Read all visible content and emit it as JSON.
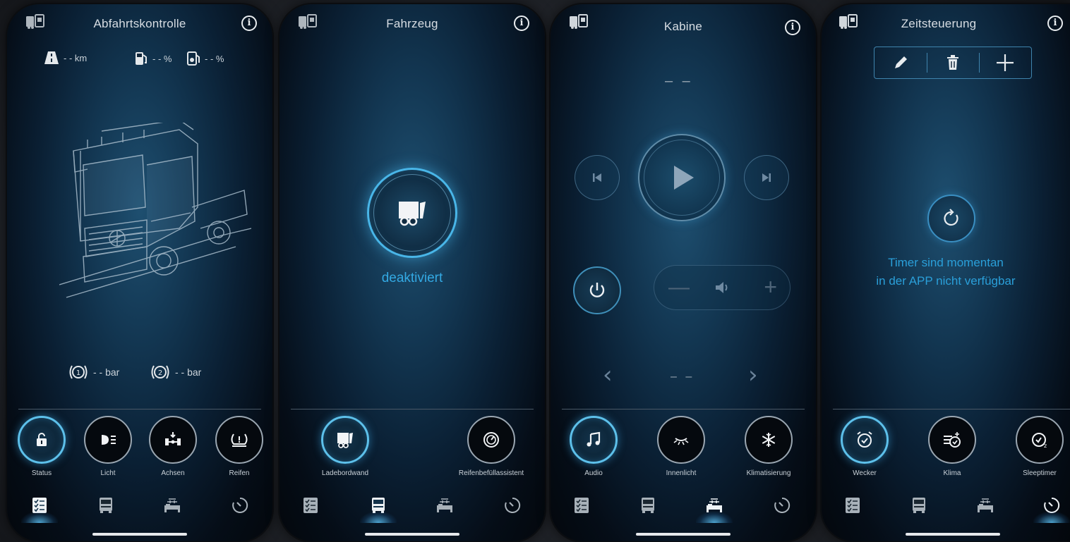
{
  "screens": [
    {
      "title": "Abfahrtskontrolle",
      "stats": {
        "range": "- - km",
        "fuel": "- - %",
        "adblue": "- - %"
      },
      "tires": [
        {
          "num": "1",
          "value": "- - bar"
        },
        {
          "num": "2",
          "value": "- - bar"
        }
      ],
      "features": [
        "Status",
        "Licht",
        "Achsen",
        "Reifen"
      ]
    },
    {
      "title": "Fahrzeug",
      "status": "deaktiviert",
      "features": [
        "Ladebordwand",
        "Reifenbefüllassistent"
      ]
    },
    {
      "title": "Kabine",
      "track": "– –",
      "source": "– –",
      "features": [
        "Audio",
        "Innenlicht",
        "Klimatisierung"
      ]
    },
    {
      "title": "Zeitsteuerung",
      "message_line1": "Timer sind momentan",
      "message_line2": "in der APP nicht verfügbar",
      "features": [
        "Wecker",
        "Klima",
        "Sleeptimer"
      ]
    }
  ],
  "colors": {
    "accent": "#49b6e8",
    "text": "#cbd3da",
    "status_blue": "#2a9fd9"
  }
}
